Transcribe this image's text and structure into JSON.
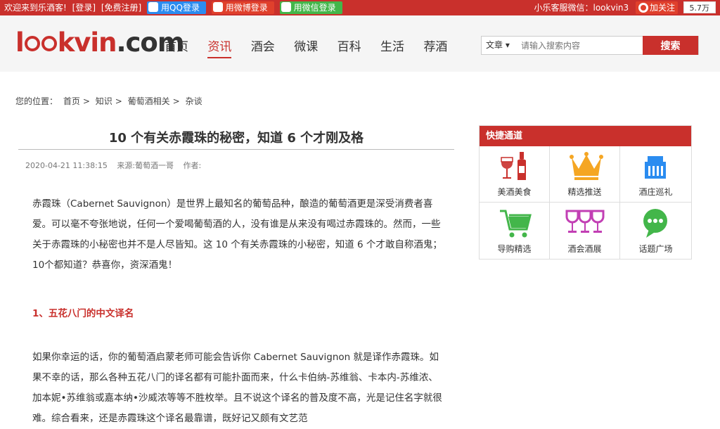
{
  "topbar": {
    "welcome": "欢迎来到乐酒客!",
    "login": "[登录]",
    "register": "[免费注册]",
    "qq_login": "用QQ登录",
    "weibo_login": "用微博登录",
    "wechat_login": "用微信登录",
    "service": "小乐客服微信：lookvin3",
    "follow": "加关注",
    "fans": "5.7万"
  },
  "logo": {
    "part1": "l",
    "part2": "kvin",
    "part3": ".com"
  },
  "nav": [
    {
      "label": "首页"
    },
    {
      "label": "资讯"
    },
    {
      "label": "酒会"
    },
    {
      "label": "微课"
    },
    {
      "label": "百科"
    },
    {
      "label": "生活"
    },
    {
      "label": "荐酒"
    }
  ],
  "search": {
    "category": "文章",
    "placeholder": "请输入搜索内容",
    "button": "搜索"
  },
  "breadcrumb": {
    "prefix": "您的位置：",
    "items": [
      "首页",
      "知识",
      "葡萄酒相关",
      "杂谈"
    ],
    "sep": ">"
  },
  "article": {
    "title": "10 个有关赤霞珠的秘密，知道 6 个才刚及格",
    "date": "2020-04-21 11:38:15",
    "source": "来源:葡萄酒一哥",
    "author": "作者:",
    "para1": "赤霞珠（Cabernet Sauvignon）是世界上最知名的葡萄品种，酿造的葡萄酒更是深受消费者喜爱。可以毫不夸张地说，任何一个爱喝葡萄酒的人，没有谁是从来没有喝过赤霞珠的。然而，一些关于赤霞珠的小秘密也并不是人尽皆知。这 10 个有关赤霞珠的小秘密，知道 6 个才敢自称酒鬼；10个都知道？恭喜你，资深酒鬼！",
    "heading1": "1、五花八门的中文译名",
    "para2": "如果你幸运的话，你的葡萄酒启蒙老师可能会告诉你 Cabernet Sauvignon 就是译作赤霞珠。如果不幸的话，那么各种五花八门的译名都有可能扑面而来，什么卡伯纳-苏维翁、卡本内-苏维浓、加本妮•苏维翁或嘉本纳•沙威浓等等不胜枚举。且不说这个译名的普及度不高，光是记住名字就很难。综合看来，还是赤霞珠这个译名最靠谱，既好记又颇有文艺范"
  },
  "sidebar": {
    "title": "快捷通道",
    "items": [
      {
        "label": "美酒美食",
        "icon": "wine-glass-bottle-icon"
      },
      {
        "label": "精选推送",
        "icon": "crown-icon"
      },
      {
        "label": "酒庄巡礼",
        "icon": "building-icon"
      },
      {
        "label": "导购精选",
        "icon": "shopping-cart-icon"
      },
      {
        "label": "酒会酒展",
        "icon": "wine-glasses-icon"
      },
      {
        "label": "话题广场",
        "icon": "chat-bubble-icon"
      }
    ]
  },
  "colors": {
    "brand_red": "#c9302c"
  }
}
